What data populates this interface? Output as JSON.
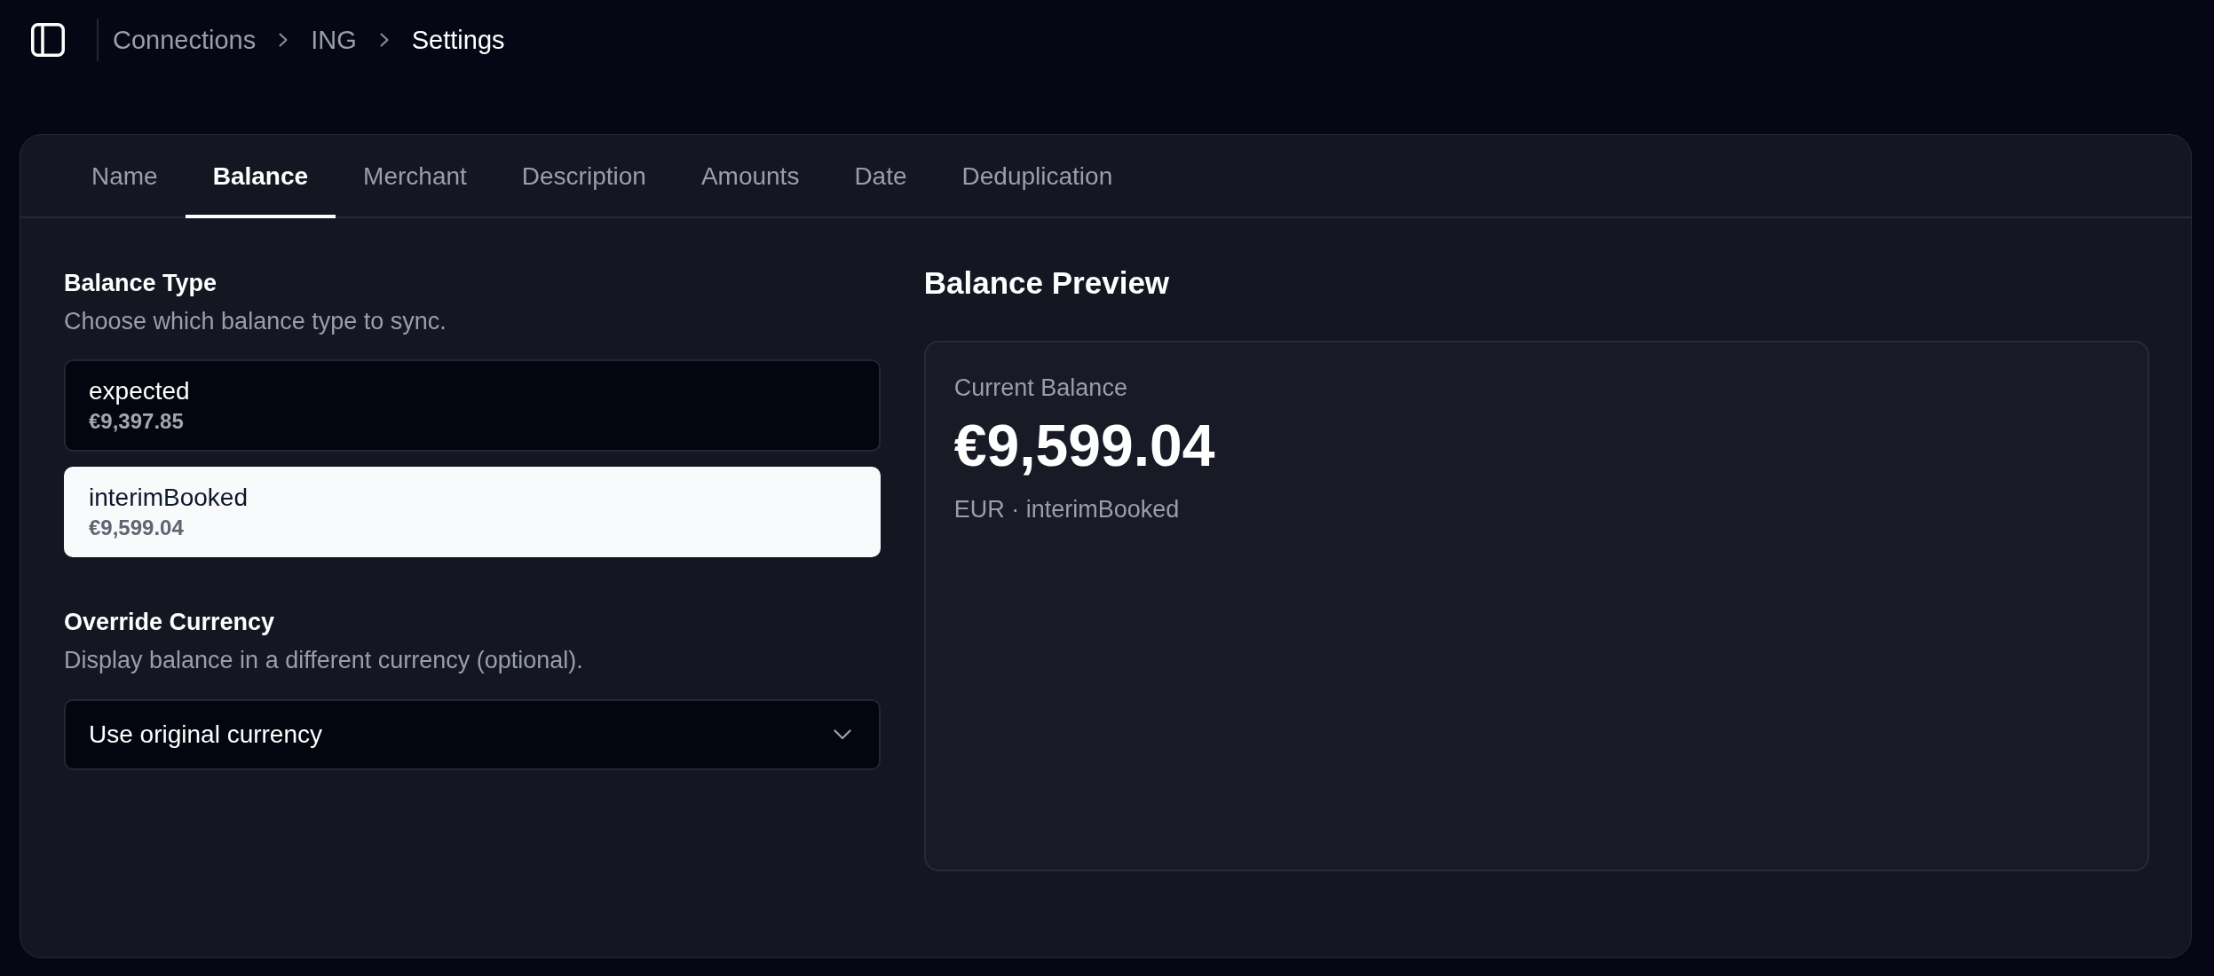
{
  "header": {
    "breadcrumbs": [
      {
        "label": "Connections",
        "current": false
      },
      {
        "label": "ING",
        "current": false
      },
      {
        "label": "Settings",
        "current": true
      }
    ]
  },
  "tabs": [
    {
      "label": "Name",
      "selected": false
    },
    {
      "label": "Balance",
      "selected": true
    },
    {
      "label": "Merchant",
      "selected": false
    },
    {
      "label": "Description",
      "selected": false
    },
    {
      "label": "Amounts",
      "selected": false
    },
    {
      "label": "Date",
      "selected": false
    },
    {
      "label": "Deduplication",
      "selected": false
    }
  ],
  "balance_type": {
    "title": "Balance Type",
    "description": "Choose which balance type to sync.",
    "options": [
      {
        "name": "expected",
        "amount": "€9,397.85",
        "selected": false
      },
      {
        "name": "interimBooked",
        "amount": "€9,599.04",
        "selected": true
      }
    ]
  },
  "override_currency": {
    "title": "Override Currency",
    "description": "Display balance in a different currency (optional).",
    "select": {
      "value": "Use original currency"
    }
  },
  "balance_preview": {
    "title": "Balance Preview",
    "label": "Current Balance",
    "amount": "€9,599.04",
    "detail": "EUR · interimBooked"
  }
}
